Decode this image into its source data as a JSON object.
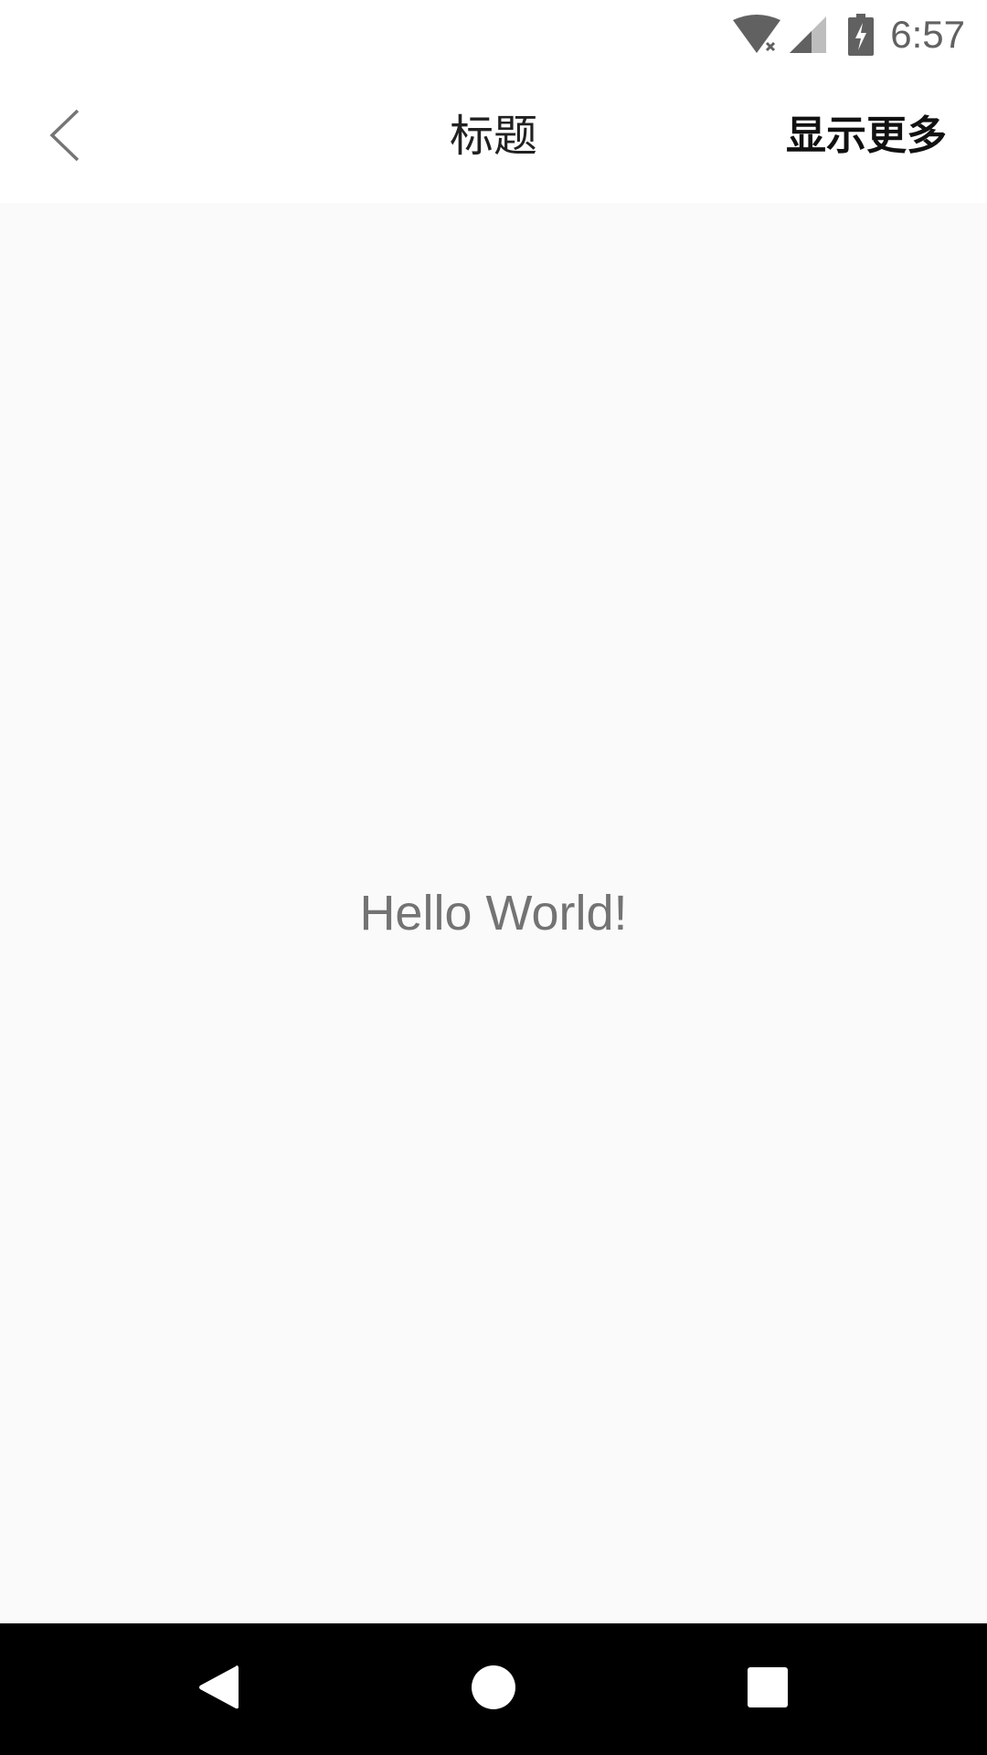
{
  "status_bar": {
    "time": "6:57",
    "icons": [
      "wifi-no-internet-icon",
      "cell-signal-icon",
      "battery-charging-icon"
    ]
  },
  "toolbar": {
    "title": "标题",
    "more_label": "显示更多",
    "back_icon": "chevron-left-icon"
  },
  "content": {
    "message": "Hello World!"
  },
  "nav_bar": {
    "icons": [
      "nav-back-icon",
      "nav-home-icon",
      "nav-recents-icon"
    ]
  },
  "colors": {
    "status_icon": "#616161",
    "title": "#212121",
    "body_text": "#737373",
    "background": "#fafafa",
    "nav_bar": "#000000"
  }
}
